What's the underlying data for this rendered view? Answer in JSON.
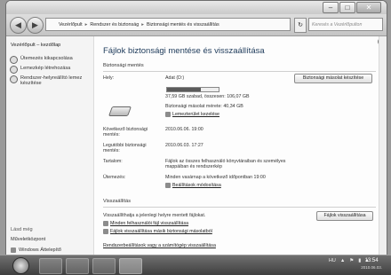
{
  "window": {
    "controls": [
      "–",
      "□",
      "✕"
    ]
  },
  "nav": {
    "back": "◀",
    "forward": "▶"
  },
  "breadcrumb": [
    "Vezérlőpult",
    "Rendszer és biztonság",
    "Biztonsági mentés és visszaállítás"
  ],
  "breadcrumb_sep": "▸",
  "search_placeholder": "Keresés a Vezérlőpulton",
  "sidebar": {
    "home": "Vezérlőpult – kezdőlap",
    "items": [
      "Ütemezés kikapcsolása",
      "Lemezkép létrehozása",
      "Rendszer-helyreállító lemez készítése"
    ],
    "see_also": "Lásd még",
    "bottom_items": [
      "Műveletközpont",
      "Windows Áttelepítő"
    ]
  },
  "main": {
    "title": "Fájlok biztonsági mentése és visszaállítása",
    "backup_section": "Biztonsági mentés",
    "location_label": "Hely:",
    "drive_name": "Adat (D:)",
    "backup_now_button": "Biztonsági másolat készítése",
    "drive_usage_fraction": 0.65,
    "drive_space": "37,59 GB szabad, összesen: 106,07 GB",
    "backup_size": "Biztonsági másolat mérete: 40,34 GB",
    "manage_space_link": "Lemezterület kezelése",
    "next_backup_label": "Következő biztonsági mentés:",
    "next_backup_value": "2010.06.06. 19:00",
    "last_backup_label": "Legutóbbi biztonsági mentés:",
    "last_backup_value": "2010.06.03. 17:27",
    "contents_label": "Tartalom:",
    "contents_value": "Fájlok az összes felhasználó könyvtáraiban és személyes mappáiban és rendszerkép",
    "schedule_label": "Ütemezés:",
    "schedule_value": "Minden vasárnap a következő időpontban 19:00",
    "change_settings_link": "Beállítások módosítása",
    "restore_section": "Visszaállítás",
    "restore_text": "Visszaállíthatja a jelenlegi helyre mentett fájlokat.",
    "restore_button": "Fájlok visszaállítása",
    "restore_all_users_link": "Minden felhasználói fájl visszaállítása",
    "restore_other_link": "Fájlok visszaállítása másik biztonsági másolatból",
    "recover_link": "Rendszerbeállítások vagy a számítógép visszaállítása"
  },
  "taskbar": {
    "tray": [
      "HU",
      "▲",
      "⚑",
      "▮",
      "◂"
    ],
    "time": "13:54",
    "date": "2010.06.03."
  }
}
